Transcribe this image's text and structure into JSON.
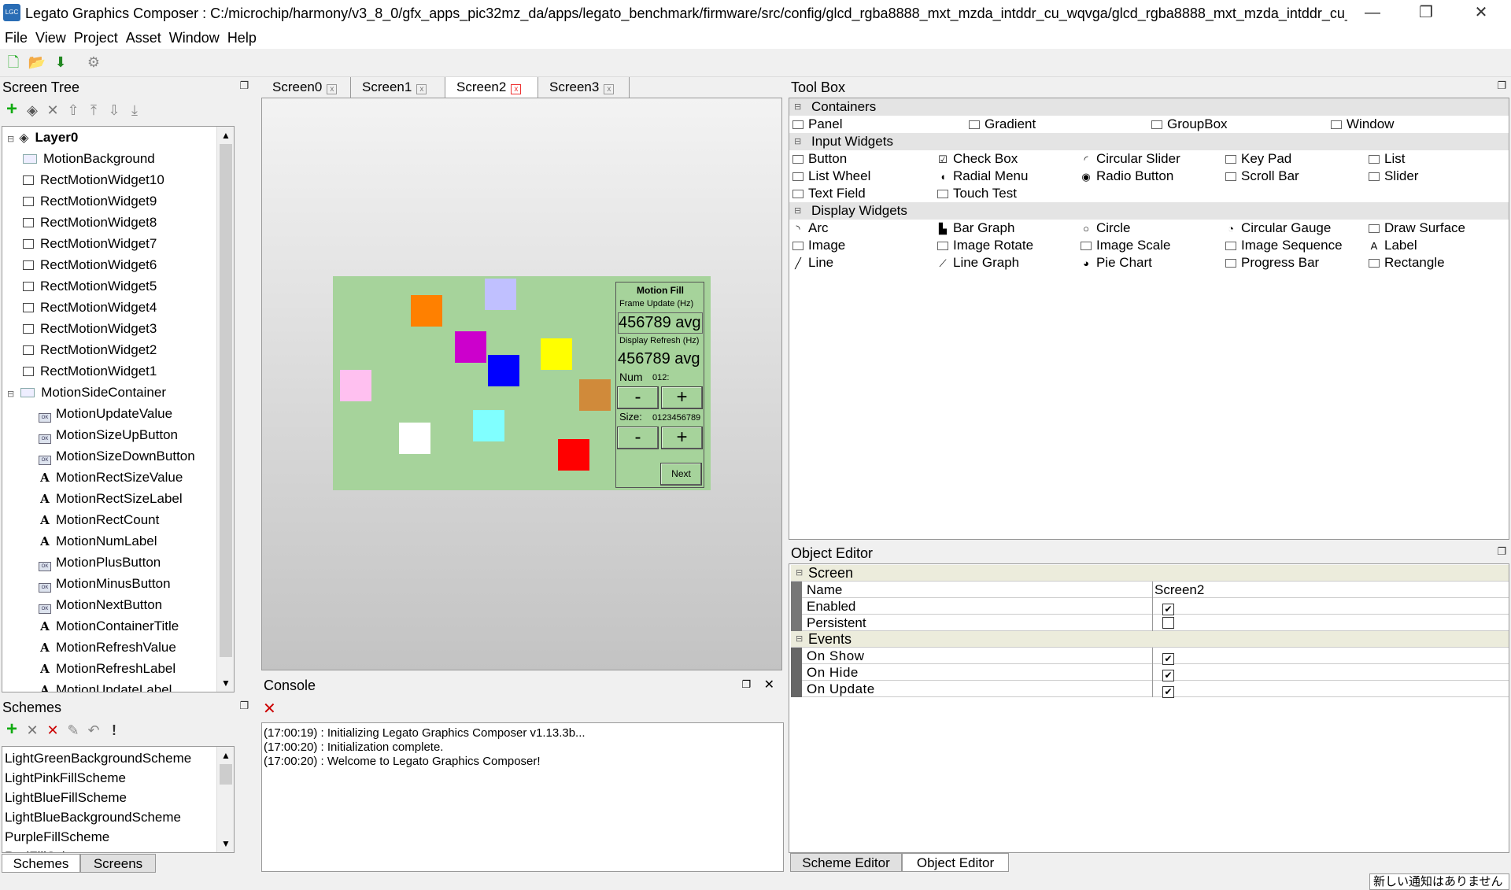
{
  "titlebar": {
    "title": "Legato Graphics Composer : C:/microchip/harmony/v3_8_0/gfx_apps_pic32mz_da/apps/legato_benchmark/firmware/src/config/glcd_rgba8888_mxt_mzda_intddr_cu_wqvga/glcd_rgba8888_mxt_mzda_intddr_cu_..."
  },
  "menu": [
    "File",
    "View",
    "Project",
    "Asset",
    "Window",
    "Help"
  ],
  "screen_tree": {
    "title": "Screen Tree",
    "items": [
      {
        "label": "Layer0",
        "depth": 0,
        "icon": "layer"
      },
      {
        "label": "MotionBackground",
        "depth": 1,
        "icon": "panel"
      },
      {
        "label": "RectMotionWidget10",
        "depth": 1,
        "icon": "rect"
      },
      {
        "label": "RectMotionWidget9",
        "depth": 1,
        "icon": "rect"
      },
      {
        "label": "RectMotionWidget8",
        "depth": 1,
        "icon": "rect"
      },
      {
        "label": "RectMotionWidget7",
        "depth": 1,
        "icon": "rect"
      },
      {
        "label": "RectMotionWidget6",
        "depth": 1,
        "icon": "rect"
      },
      {
        "label": "RectMotionWidget5",
        "depth": 1,
        "icon": "rect"
      },
      {
        "label": "RectMotionWidget4",
        "depth": 1,
        "icon": "rect"
      },
      {
        "label": "RectMotionWidget3",
        "depth": 1,
        "icon": "rect"
      },
      {
        "label": "RectMotionWidget2",
        "depth": 1,
        "icon": "rect"
      },
      {
        "label": "RectMotionWidget1",
        "depth": 1,
        "icon": "rect"
      },
      {
        "label": "MotionSideContainer",
        "depth": 1,
        "icon": "panel"
      },
      {
        "label": "MotionUpdateValue",
        "depth": 2,
        "icon": "button"
      },
      {
        "label": "MotionSizeUpButton",
        "depth": 2,
        "icon": "button"
      },
      {
        "label": "MotionSizeDownButton",
        "depth": 2,
        "icon": "button"
      },
      {
        "label": "MotionRectSizeValue",
        "depth": 2,
        "icon": "label"
      },
      {
        "label": "MotionRectSizeLabel",
        "depth": 2,
        "icon": "label"
      },
      {
        "label": "MotionRectCount",
        "depth": 2,
        "icon": "label"
      },
      {
        "label": "MotionNumLabel",
        "depth": 2,
        "icon": "label"
      },
      {
        "label": "MotionPlusButton",
        "depth": 2,
        "icon": "button"
      },
      {
        "label": "MotionMinusButton",
        "depth": 2,
        "icon": "button"
      },
      {
        "label": "MotionNextButton",
        "depth": 2,
        "icon": "button"
      },
      {
        "label": "MotionContainerTitle",
        "depth": 2,
        "icon": "label"
      },
      {
        "label": "MotionRefreshValue",
        "depth": 2,
        "icon": "label"
      },
      {
        "label": "MotionRefreshLabel",
        "depth": 2,
        "icon": "label"
      },
      {
        "label": "MotionUpdateLabel",
        "depth": 2,
        "icon": "label"
      }
    ]
  },
  "schemes": {
    "title": "Schemes",
    "items": [
      "LightGreenBackgroundScheme",
      "LightPinkFillScheme",
      "LightBlueFillScheme",
      "LightBlueBackgroundScheme",
      "PurpleFillScheme",
      "RedFillScheme"
    ],
    "tabs": [
      "Schemes",
      "Screens"
    ]
  },
  "tabs": [
    {
      "label": "Screen0",
      "active": false
    },
    {
      "label": "Screen1",
      "active": false
    },
    {
      "label": "Screen2",
      "active": true
    },
    {
      "label": "Screen3",
      "active": false
    }
  ],
  "preview": {
    "background": "#a6d39b",
    "title": "Motion Fill",
    "frame_label": "Frame Update (Hz)",
    "frame_value": "456789 avg",
    "refresh_label": "Display Refresh (Hz)",
    "refresh_value": "456789 avg",
    "num_label": "Num",
    "num_value": "012:",
    "size_label": "Size:",
    "size_value": "0123456789",
    "minus": "-",
    "plus": "+",
    "next": "Next"
  },
  "console": {
    "title": "Console",
    "lines": [
      "(17:00:19) : Initializing Legato Graphics Composer v1.13.3b...",
      "(17:00:20) : Initialization complete.",
      "(17:00:20) : Welcome to Legato Graphics Composer!"
    ]
  },
  "toolbox": {
    "title": "Tool Box",
    "sections": [
      {
        "name": "Containers",
        "items": [
          "Panel",
          "Gradient",
          "GroupBox",
          "Window"
        ]
      },
      {
        "name": "Input Widgets",
        "items": [
          "Button",
          "Check Box",
          "Circular Slider",
          "Key Pad",
          "List",
          "List Wheel",
          "Radial Menu",
          "Radio Button",
          "Scroll Bar",
          "Slider",
          "Text Field",
          "Touch Test"
        ]
      },
      {
        "name": "Display Widgets",
        "items": [
          "Arc",
          "Bar Graph",
          "Circle",
          "Circular Gauge",
          "Draw Surface",
          "Image",
          "Image Rotate",
          "Image Scale",
          "Image Sequence",
          "Label",
          "Line",
          "Line Graph",
          "Pie Chart",
          "Progress Bar",
          "Rectangle"
        ]
      }
    ]
  },
  "object_editor": {
    "title": "Object Editor",
    "sections": [
      {
        "name": "Screen",
        "props": [
          {
            "key": "Name",
            "value": "Screen2",
            "type": "text"
          },
          {
            "key": "Enabled",
            "value": "✔",
            "type": "check"
          },
          {
            "key": "Persistent",
            "value": "",
            "type": "check"
          }
        ]
      },
      {
        "name": "Events",
        "props": [
          {
            "key": "On Show",
            "value": "✔",
            "type": "check"
          },
          {
            "key": "On Hide",
            "value": "✔",
            "type": "check"
          },
          {
            "key": "On Update",
            "value": "✔",
            "type": "check"
          }
        ]
      }
    ],
    "tabs": [
      "Scheme Editor",
      "Object Editor"
    ]
  },
  "notification": "新しい通知はありません"
}
